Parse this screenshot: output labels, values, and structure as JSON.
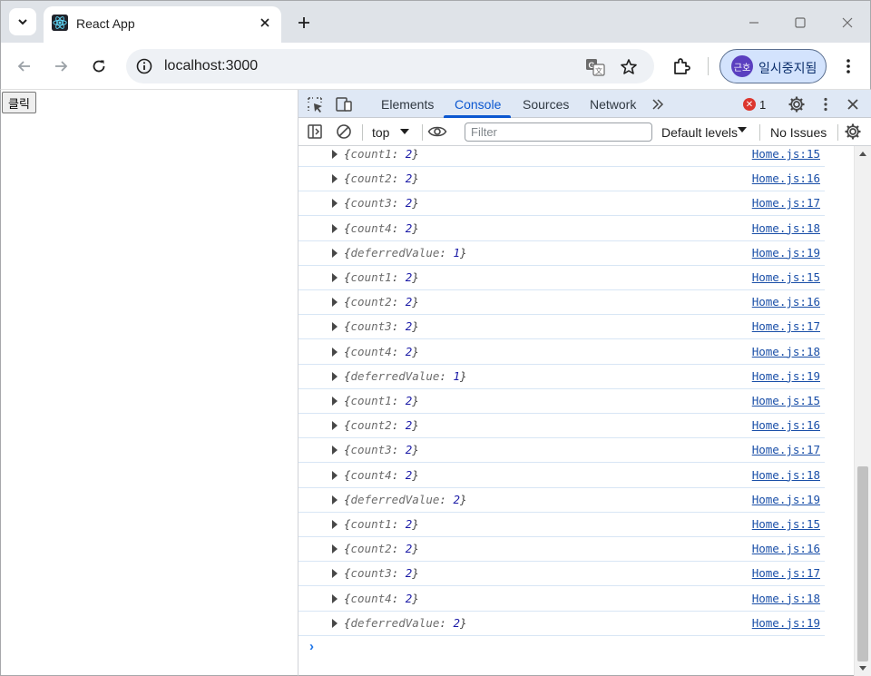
{
  "browser": {
    "tab_title": "React App",
    "url": "localhost:3000",
    "profile_avatar_text": "근호",
    "profile_label": "일시중지됨"
  },
  "page": {
    "button_label": "클릭"
  },
  "devtools": {
    "tabs": [
      "Elements",
      "Console",
      "Sources",
      "Network"
    ],
    "active_tab": "Console",
    "error_count": "1",
    "context": "top",
    "filter_placeholder": "Filter",
    "levels_label": "Default levels",
    "issues_label": "No Issues",
    "scroll_thumb_fraction": 0.39
  },
  "console": {
    "logs": [
      {
        "key": "count1",
        "value": "2",
        "source": "Home.js:15"
      },
      {
        "key": "count2",
        "value": "2",
        "source": "Home.js:16"
      },
      {
        "key": "count3",
        "value": "2",
        "source": "Home.js:17"
      },
      {
        "key": "count4",
        "value": "2",
        "source": "Home.js:18"
      },
      {
        "key": "deferredValue",
        "value": "1",
        "source": "Home.js:19"
      },
      {
        "key": "count1",
        "value": "2",
        "source": "Home.js:15"
      },
      {
        "key": "count2",
        "value": "2",
        "source": "Home.js:16"
      },
      {
        "key": "count3",
        "value": "2",
        "source": "Home.js:17"
      },
      {
        "key": "count4",
        "value": "2",
        "source": "Home.js:18"
      },
      {
        "key": "deferredValue",
        "value": "1",
        "source": "Home.js:19"
      },
      {
        "key": "count1",
        "value": "2",
        "source": "Home.js:15"
      },
      {
        "key": "count2",
        "value": "2",
        "source": "Home.js:16"
      },
      {
        "key": "count3",
        "value": "2",
        "source": "Home.js:17"
      },
      {
        "key": "count4",
        "value": "2",
        "source": "Home.js:18"
      },
      {
        "key": "deferredValue",
        "value": "2",
        "source": "Home.js:19"
      },
      {
        "key": "count1",
        "value": "2",
        "source": "Home.js:15"
      },
      {
        "key": "count2",
        "value": "2",
        "source": "Home.js:16"
      },
      {
        "key": "count3",
        "value": "2",
        "source": "Home.js:17"
      },
      {
        "key": "count4",
        "value": "2",
        "source": "Home.js:18"
      },
      {
        "key": "deferredValue",
        "value": "2",
        "source": "Home.js:19"
      }
    ],
    "prompt_symbol": "›"
  },
  "colors": {
    "accent": "#0b57d0",
    "error": "#dc362e",
    "profile_bg": "#d3e3fd"
  }
}
